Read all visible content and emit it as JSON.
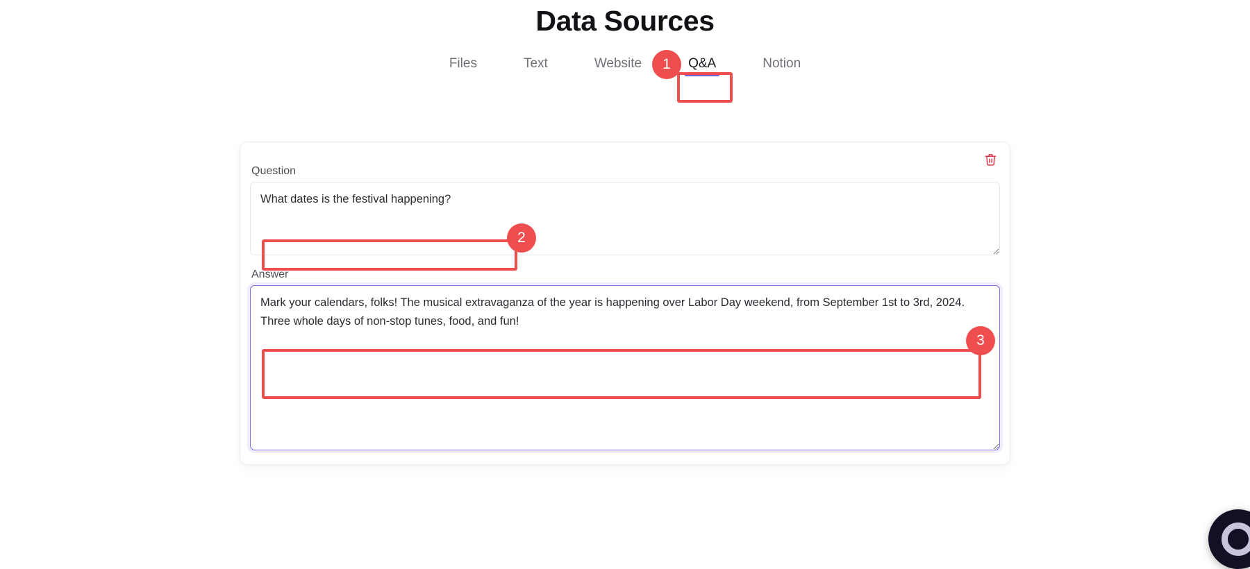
{
  "page": {
    "title": "Data Sources"
  },
  "tabs": {
    "items": [
      {
        "label": "Files",
        "active": false
      },
      {
        "label": "Text",
        "active": false
      },
      {
        "label": "Website",
        "active": false
      },
      {
        "label": "Q&A",
        "active": true
      },
      {
        "label": "Notion",
        "active": false
      }
    ],
    "active_underline_color": "#7c5cdb"
  },
  "card": {
    "delete_icon": "trash-icon",
    "delete_icon_color": "#dc3545",
    "question": {
      "label": "Question",
      "value": "What dates is the festival happening?",
      "placeholder": "Question"
    },
    "answer": {
      "label": "Answer",
      "value": "Mark your calendars, folks! The musical extravaganza of the year is happening over Labor Day weekend, from September 1st to 3rd, 2024. Three whole days of non-stop tunes, food, and fun!",
      "placeholder": "Answer",
      "focused": true,
      "focus_border_color": "#8b6fe0"
    }
  },
  "annotations": {
    "color": "#ef4e4e",
    "markers": [
      {
        "number": "1",
        "target": "tab-qa"
      },
      {
        "number": "2",
        "target": "question-input"
      },
      {
        "number": "3",
        "target": "answer-input"
      }
    ]
  },
  "chat_widget": {
    "icon": "chat-bubble-icon"
  }
}
